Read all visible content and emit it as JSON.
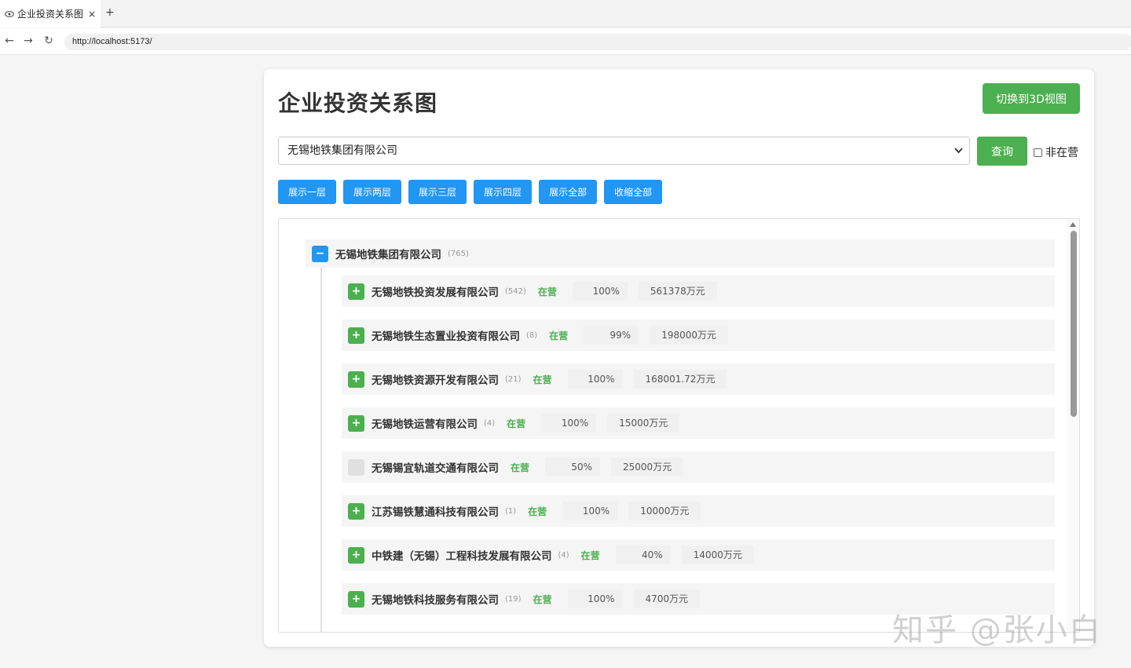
{
  "browser": {
    "tab_title": "企业投资关系图",
    "tab_close": "×",
    "new_tab": "+",
    "back": "←",
    "forward": "→",
    "reload": "↻",
    "url": "http://localhost:5173/"
  },
  "header": {
    "title": "企业投资关系图",
    "switch_3d_label": "切换到3D视图"
  },
  "search": {
    "selected_company": "无锡地铁集团有限公司",
    "query_label": "查询",
    "inactive_label": "非在营",
    "inactive_checked": false
  },
  "level_buttons": [
    "展示一层",
    "展示两层",
    "展示三层",
    "展示四层",
    "展示全部",
    "收缩全部"
  ],
  "tree": {
    "root": {
      "name": "无锡地铁集团有限公司",
      "count": "(765)",
      "toggle": "−"
    },
    "children": [
      {
        "toggle": "+",
        "name": "无锡地铁投资发展有限公司",
        "count": "(542)",
        "status": "在营",
        "percent": "100%",
        "amount": "561378万元"
      },
      {
        "toggle": "+",
        "name": "无锡地铁生态置业投资有限公司",
        "count": "(8)",
        "status": "在营",
        "percent": "99%",
        "amount": "198000万元"
      },
      {
        "toggle": "+",
        "name": "无锡地铁资源开发有限公司",
        "count": "(21)",
        "status": "在营",
        "percent": "100%",
        "amount": "168001.72万元"
      },
      {
        "toggle": "+",
        "name": "无锡地铁运营有限公司",
        "count": "(4)",
        "status": "在营",
        "percent": "100%",
        "amount": "15000万元"
      },
      {
        "toggle": "",
        "name": "无锡锡宜轨道交通有限公司",
        "count": "",
        "status": "在营",
        "percent": "50%",
        "amount": "25000万元"
      },
      {
        "toggle": "+",
        "name": "江苏锡铁慧通科技有限公司",
        "count": "(1)",
        "status": "在营",
        "percent": "100%",
        "amount": "10000万元"
      },
      {
        "toggle": "+",
        "name": "中铁建（无锡）工程科技发展有限公司",
        "count": "(4)",
        "status": "在营",
        "percent": "40%",
        "amount": "14000万元"
      },
      {
        "toggle": "+",
        "name": "无锡地铁科技服务有限公司",
        "count": "(19)",
        "status": "在营",
        "percent": "100%",
        "amount": "4700万元"
      }
    ]
  },
  "watermark": "知乎 @张小白",
  "colors": {
    "primary_blue": "#2196f3",
    "green": "#4caf50",
    "status_green": "#4caf50"
  }
}
